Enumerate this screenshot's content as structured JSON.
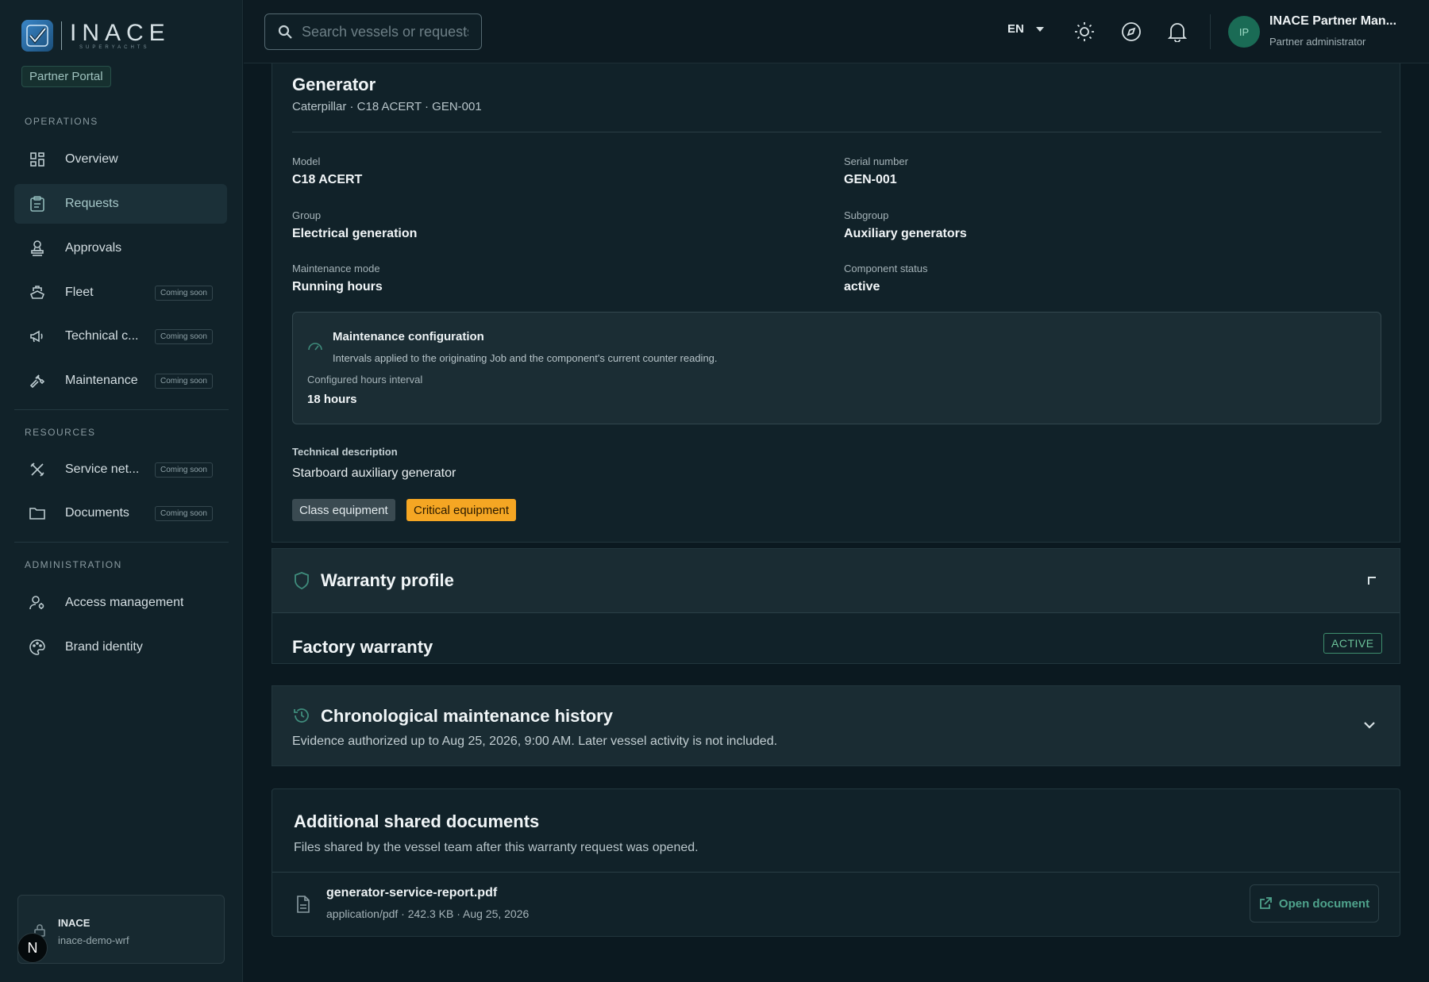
{
  "brand": {
    "name": "INACE",
    "sub": "SUPERYACHTS",
    "portal_badge": "Partner Portal"
  },
  "sidebar": {
    "sections": {
      "operations": "OPERATIONS",
      "resources": "RESOURCES",
      "administration": "ADMINISTRATION"
    },
    "coming_soon": "Coming soon",
    "items": [
      {
        "label": "Overview",
        "icon": "grid-icon"
      },
      {
        "label": "Requests",
        "icon": "clipboard-icon",
        "active": true
      },
      {
        "label": "Approvals",
        "icon": "stamp-icon"
      },
      {
        "label": "Fleet",
        "icon": "ship-icon",
        "coming_soon": true
      },
      {
        "label": "Technical c...",
        "icon": "megaphone-icon",
        "coming_soon": true
      },
      {
        "label": "Maintenance",
        "icon": "wrench-icon",
        "coming_soon": true
      },
      {
        "label": "Service net...",
        "icon": "tools-icon",
        "coming_soon": true
      },
      {
        "label": "Documents",
        "icon": "folder-icon",
        "coming_soon": true
      },
      {
        "label": "Access management",
        "icon": "user-key-icon"
      },
      {
        "label": "Brand identity",
        "icon": "palette-icon"
      }
    ],
    "tenant": {
      "name": "INACE",
      "id": "inace-demo-wrf"
    },
    "bottom_avatar": "N"
  },
  "topbar": {
    "search_placeholder": "Search vessels or requests",
    "language": "EN",
    "user": {
      "initials": "IP",
      "name": "INACE Partner Man...",
      "role": "Partner administrator"
    }
  },
  "component": {
    "title": "Generator",
    "subtitle": "Caterpillar · C18 ACERT · GEN-001",
    "fields": {
      "model_label": "Model",
      "model": "C18 ACERT",
      "serial_label": "Serial number",
      "serial": "GEN-001",
      "group_label": "Group",
      "group": "Electrical generation",
      "subgroup_label": "Subgroup",
      "subgroup": "Auxiliary generators",
      "mode_label": "Maintenance mode",
      "mode": "Running hours",
      "status_label": "Component status",
      "status": "active"
    },
    "maintenance_config": {
      "title": "Maintenance configuration",
      "description": "Intervals applied to the originating Job and the component's current counter reading.",
      "interval_label": "Configured hours interval",
      "interval_value": "18 hours"
    },
    "tech_desc_label": "Technical description",
    "tech_desc": "Starboard auxiliary generator",
    "tags": {
      "class": "Class equipment",
      "critical": "Critical equipment"
    }
  },
  "warranty": {
    "title": "Warranty profile",
    "factory_title": "Factory warranty",
    "status": "ACTIVE"
  },
  "history": {
    "title": "Chronological maintenance history",
    "note": "Evidence authorized up to Aug 25, 2026, 9:00 AM. Later vessel activity is not included."
  },
  "documents": {
    "title": "Additional shared documents",
    "subtitle": "Files shared by the vessel team after this warranty request was opened.",
    "file": {
      "name": "generator-service-report.pdf",
      "meta": "application/pdf · 242.3 KB · Aug 25, 2026"
    },
    "open_label": "Open document"
  },
  "colors": {
    "accent": "#4fa38c",
    "critical": "#f5a623",
    "active_badge": "#6cc39a",
    "background": "#0b1920"
  }
}
